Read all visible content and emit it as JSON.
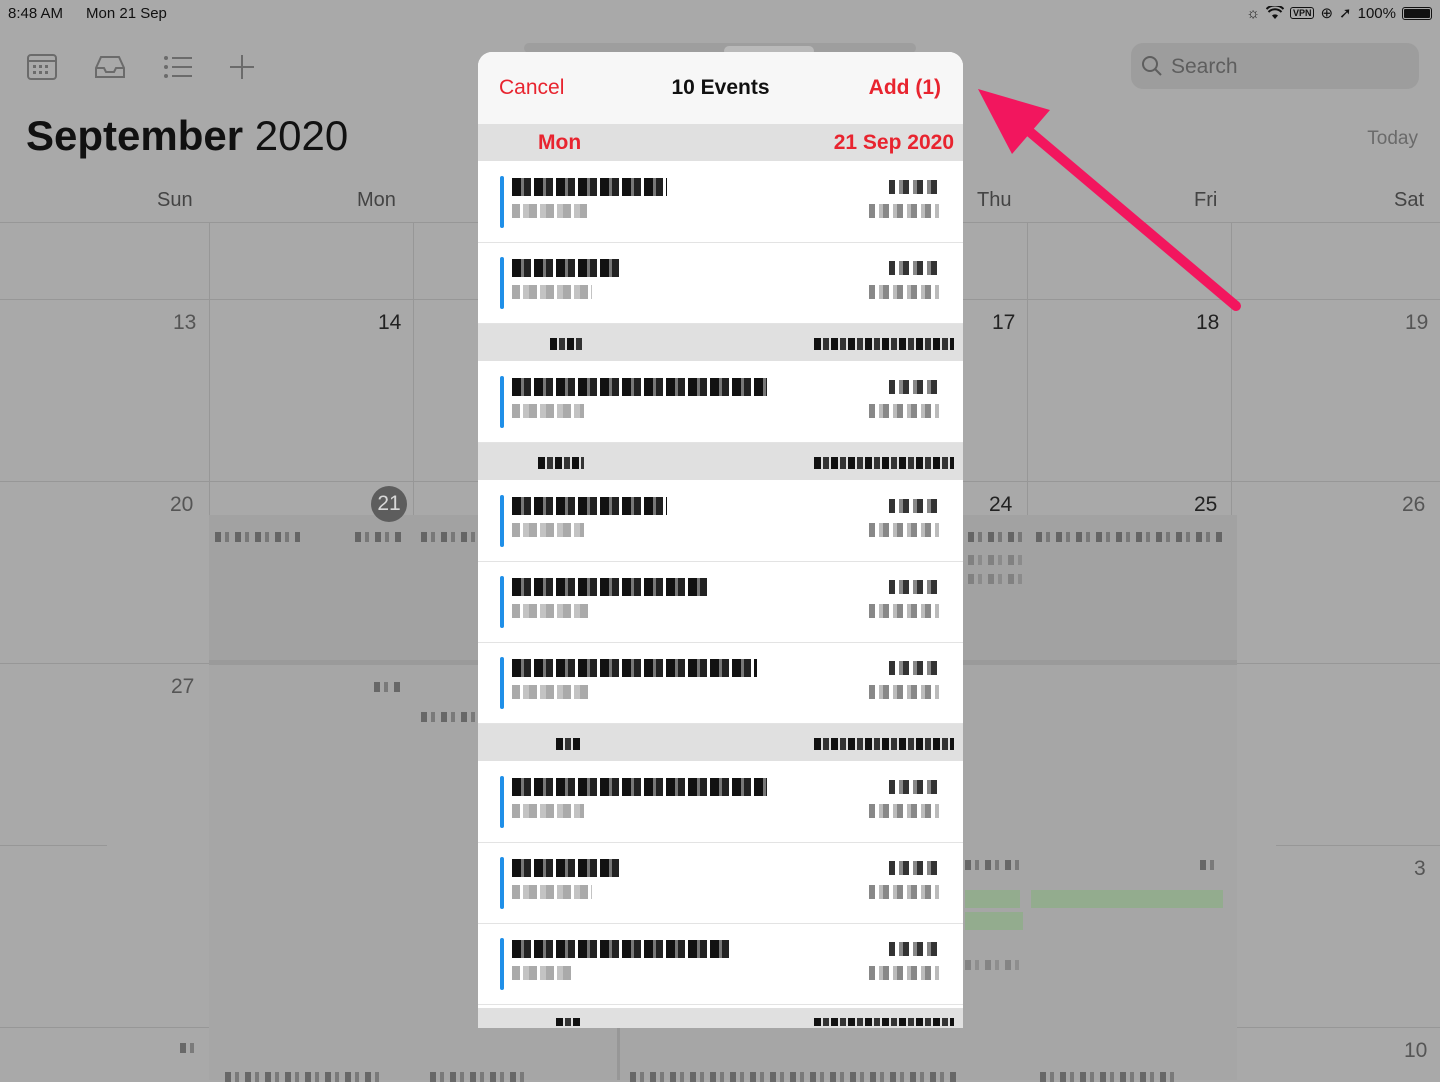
{
  "status_bar": {
    "time": "8:48 AM",
    "date": "Mon 21 Sep",
    "vpn": "VPN",
    "battery": "100%"
  },
  "toolbar": {
    "search_placeholder": "Search",
    "today_label": "Today"
  },
  "calendar": {
    "month": "September",
    "year": "2020",
    "weekdays": [
      "Sun",
      "Mon",
      "Thu",
      "Fri",
      "Sat"
    ],
    "week1": [
      "13",
      "14",
      "17",
      "18",
      "19"
    ],
    "week2": [
      "20",
      "21",
      "24",
      "25",
      "26"
    ],
    "week3": [
      "27",
      "3"
    ],
    "week4": [
      "10"
    ]
  },
  "popover": {
    "cancel_label": "Cancel",
    "title": "10 Events",
    "add_label": "Add (1)",
    "first_section": {
      "day": "Mon",
      "date": "21 Sep 2020"
    }
  },
  "colors": {
    "accent_red": "#e8242f",
    "event_blue": "#1f8fe8",
    "annotation_arrow": "#f2165e"
  }
}
